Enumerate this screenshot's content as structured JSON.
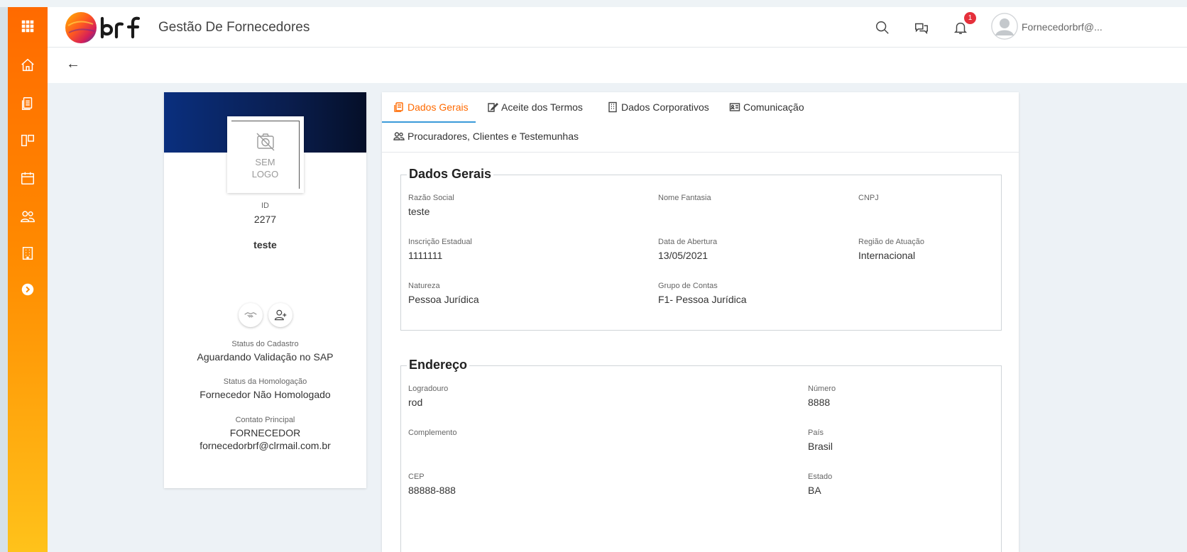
{
  "header": {
    "app_title": "Gestão De Fornecedores",
    "notification_count": "1",
    "user_name": "Fornecedorbrf@..."
  },
  "sidebar": {
    "items": [
      "apps-grid-icon",
      "home-icon",
      "documents-icon",
      "kanban-icon",
      "calendar-icon",
      "users-icon",
      "building-icon",
      "expand-icon"
    ]
  },
  "subbar": {
    "back": "←"
  },
  "profile": {
    "logo_line1": "SEM",
    "logo_line2": "LOGO",
    "id_label": "ID",
    "id_value": "2277",
    "name": "teste",
    "status_cadastro_label": "Status do Cadastro",
    "status_cadastro_value": "Aguardando Validação no SAP",
    "status_homologacao_label": "Status da Homologação",
    "status_homologacao_value": "Fornecedor Não Homologado",
    "contato_label": "Contato Principal",
    "contato_name": "FORNECEDOR",
    "contato_email": "fornecedorbrf@clrmail.com.br"
  },
  "tabs": [
    {
      "label": "Dados Gerais",
      "active": true
    },
    {
      "label": "Aceite dos Termos"
    },
    {
      "label": "Dados Corporativos"
    },
    {
      "label": "Comunicação"
    },
    {
      "label": "Procuradores, Clientes e Testemunhas"
    }
  ],
  "dados_gerais": {
    "title": "Dados Gerais",
    "razao_social": {
      "label": "Razão Social",
      "value": "teste"
    },
    "nome_fantasia": {
      "label": "Nome Fantasia",
      "value": ""
    },
    "cnpj": {
      "label": "CNPJ",
      "value": ""
    },
    "inscricao_estadual": {
      "label": "Inscrição Estadual",
      "value": "1111111"
    },
    "data_abertura": {
      "label": "Data de Abertura",
      "value": "13/05/2021"
    },
    "regiao_atuacao": {
      "label": "Região de Atuação",
      "value": "Internacional"
    },
    "natureza": {
      "label": "Natureza",
      "value": "Pessoa Jurídica"
    },
    "grupo_contas": {
      "label": "Grupo de Contas",
      "value": "F1- Pessoa Jurídica"
    }
  },
  "endereco": {
    "title": "Endereço",
    "logradouro": {
      "label": "Logradouro",
      "value": "rod"
    },
    "numero": {
      "label": "Número",
      "value": "8888"
    },
    "complemento": {
      "label": "Complemento",
      "value": ""
    },
    "pais": {
      "label": "País",
      "value": "Brasil"
    },
    "cep": {
      "label": "CEP",
      "value": "88888-888"
    },
    "estado": {
      "label": "Estado",
      "value": "BA"
    }
  },
  "colors": {
    "sidebar_top": "#ff6a00",
    "sidebar_bottom": "#ffc21a",
    "active_tab": "#ff6a00",
    "tab_underline": "#3a9ad9",
    "badge": "#e5303b",
    "banner": "#0a2f7e"
  }
}
